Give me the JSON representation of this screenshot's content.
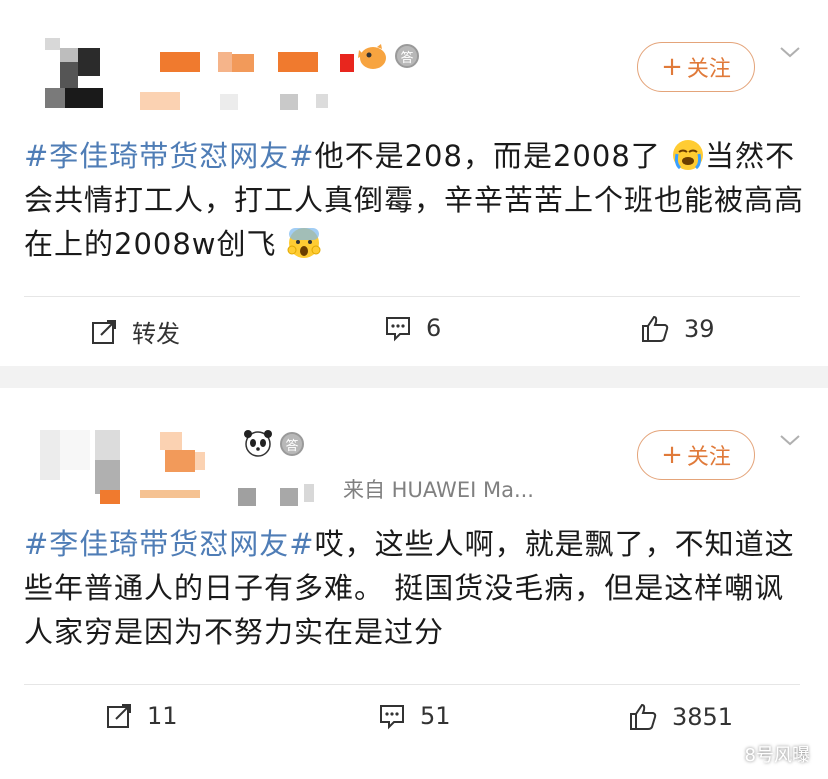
{
  "posts": [
    {
      "follow_label": "关注",
      "topic": "#李佳琦带货怼网友#",
      "body": "他不是208，而是2008了",
      "body_cont": "当然不会共情打工人，打工人真倒霉，辛辛苦苦上个班也能被高高在上的2008w创飞",
      "emoji_1": "crying-face-icon",
      "emoji_2": "screaming-face-icon",
      "badge_text": "答",
      "actions": {
        "repost": "转发",
        "comments": "6",
        "likes": "39"
      }
    },
    {
      "follow_label": "关注",
      "source": "来自 HUAWEI Ma...",
      "topic": "#李佳琦带货怼网友#",
      "body": "哎，这些人啊，就是飘了，不知道这些年普通人的日子有多难。 挺国货没毛病，但是这样嘲讽人家穷是因为不努力实在是过分",
      "badge_text": "答",
      "actions": {
        "repost": "11",
        "comments": "51",
        "likes": "3851"
      }
    }
  ],
  "watermark": "8号风曝",
  "colors": {
    "topic": "#4f7db6",
    "follow": "#e07a3a",
    "background": "#f2f2f2"
  }
}
